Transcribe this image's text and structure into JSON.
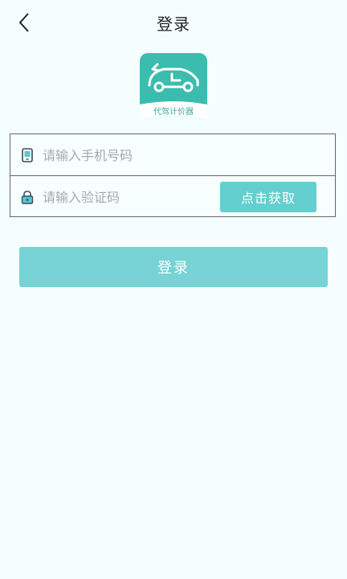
{
  "header": {
    "title": "登录",
    "back_icon": "chevron-left-icon"
  },
  "logo": {
    "caption": "代驾计价器",
    "icon": "car-meter-icon",
    "color": "#3cbcae"
  },
  "form": {
    "phone": {
      "icon": "phone-icon",
      "placeholder": "请输入手机号码",
      "value": ""
    },
    "code": {
      "icon": "lock-icon",
      "placeholder": "请输入验证码",
      "value": "",
      "get_code_label": "点击获取"
    }
  },
  "login_button": {
    "label": "登录",
    "color": "#77d3d5"
  }
}
